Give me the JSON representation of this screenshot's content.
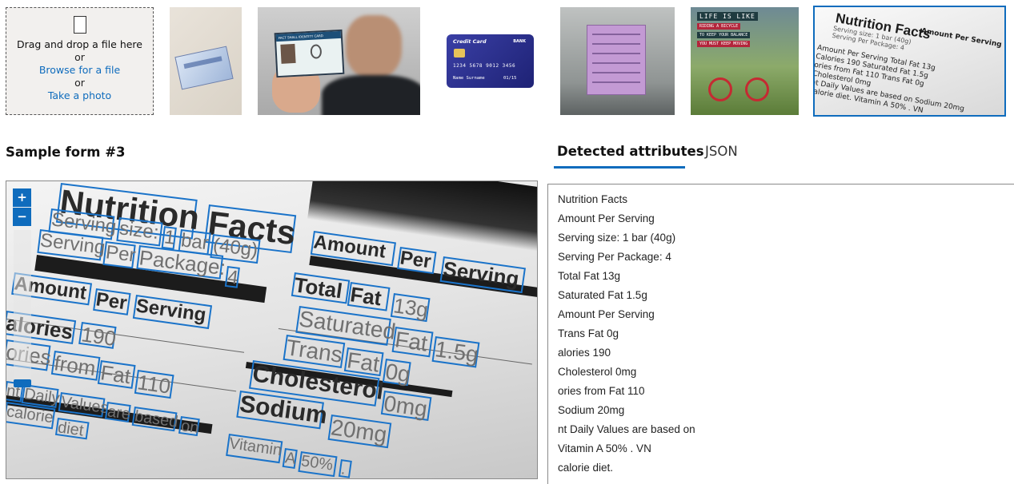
{
  "upload": {
    "drag_text": "Drag and drop a file here",
    "or_1": "or",
    "browse_link": "Browse for a file",
    "or_2": "or",
    "photo_link": "Take a photo"
  },
  "thumbnails": [
    {
      "name": "social-security-card-thumbnail",
      "caption": ""
    },
    {
      "name": "identity-card-thumbnail",
      "idcard_header": "FACT SHALL IDENTITY CARD"
    },
    {
      "name": "credit-card-thumbnail",
      "card_title": "Credit Card",
      "bank": "BANK",
      "number": "1234  5678  9012  3456",
      "holder": "Name Surname",
      "expiry": "01/15"
    },
    {
      "name": "sticky-note-thumbnail"
    },
    {
      "name": "bicycle-poster-thumbnail",
      "line1": "LIFE IS LIKE",
      "line2": "RIDING A BICYCLE",
      "line3": "TO KEEP YOUR BALANCE",
      "line4": "YOU MUST KEEP MOVING"
    },
    {
      "name": "nutrition-facts-thumbnail",
      "title": "Nutrition Facts",
      "sub1": "Serving size: 1 bar (40g)",
      "sub2": "Serving Per Package: 4",
      "amount": "Amount Per Serving",
      "lines": [
        "Amount Per Serving       Total Fat 13g",
        "Calories 190         Saturated Fat 1.5g",
        "ories from Fat 110     Trans Fat 0g",
        "                    Cholesterol 0mg",
        "nt Daily Values are based on   Sodium 20mg",
        "calorie diet.          Vitamin A 50% . VN"
      ]
    }
  ],
  "sample": {
    "title": "Sample form #3"
  },
  "tabs": {
    "detected": "Detected attributes",
    "json": "JSON",
    "active": "detected"
  },
  "zoom": {
    "in_label": "+",
    "out_label": "−"
  },
  "viewer_words": {
    "w1": "Nutrition",
    "w2": "Facts",
    "w3": "Serving",
    "w4": "size:",
    "w5": "1",
    "w6": "bar",
    "w7": "(40g)",
    "w8": "Serving",
    "w9": "Per",
    "w10": "Package:",
    "w11": "4",
    "w12": "Amount",
    "w13": "Per",
    "w14": "Serving",
    "w15": "alories",
    "w16": "190",
    "w17": "ories",
    "w18": "from",
    "w19": "Fat",
    "w20": "110",
    "w21": "nt",
    "w22": "Daily",
    "w23": "Values",
    "w24": "are",
    "w25": "based",
    "w26": "on",
    "w27": "calorie",
    "w28": "diet",
    "w29": "Amount",
    "w30": "Per",
    "w31": "Serving",
    "w32": "Total",
    "w33": "Fat",
    "w34": "13g",
    "w35": "Saturated",
    "w36": "Fat",
    "w37": "1.5g",
    "w38": "Trans",
    "w39": "Fat",
    "w40": "0g",
    "w41": "Cholesterol",
    "w42": "0mg",
    "w43": "Sodium",
    "w44": "20mg",
    "w45": "Vitamin",
    "w46": "A",
    "w47": "50%",
    "w48": "."
  },
  "detected_lines": [
    "Nutrition Facts",
    "Amount Per Serving",
    "Serving size: 1 bar (40g)",
    "Serving Per Package: 4",
    "Total Fat 13g",
    "Saturated Fat 1.5g",
    "Amount Per Serving",
    "Trans Fat 0g",
    "alories 190",
    "Cholesterol 0mg",
    "ories from Fat 110",
    "Sodium 20mg",
    "nt Daily Values are based on",
    "Vitamin A 50% . VN",
    "calorie diet."
  ],
  "colors": {
    "accent": "#0f6cbd",
    "box_outline": "#1a73c9"
  }
}
